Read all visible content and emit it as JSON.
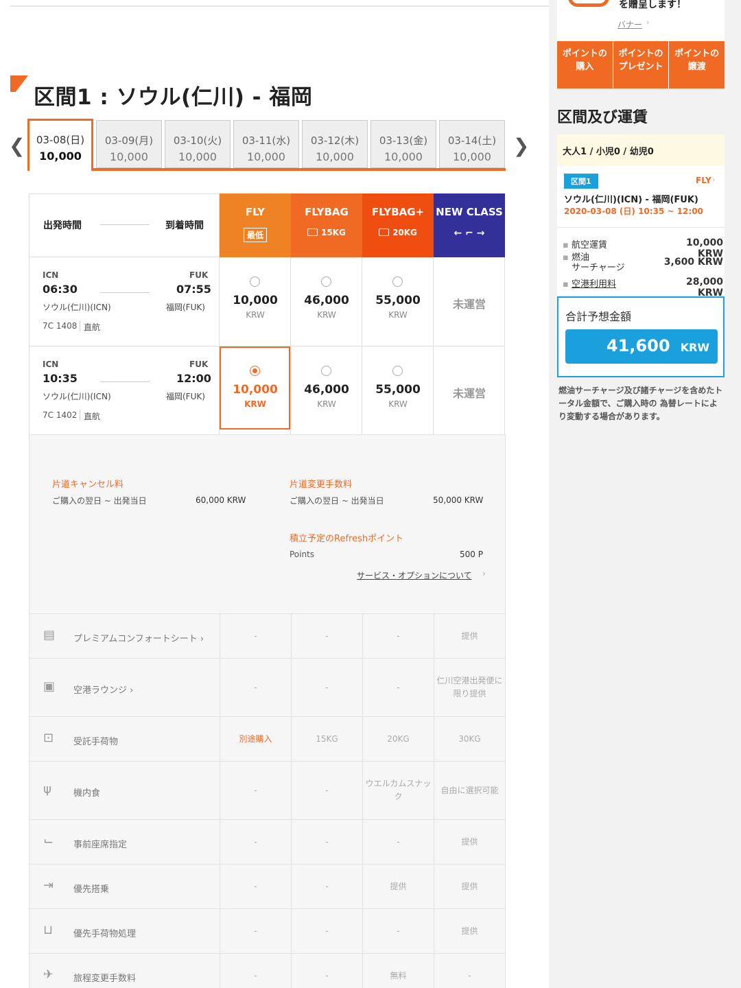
{
  "promo": {
    "text": "を贈呈します！",
    "link": "バナー"
  },
  "point_buttons": [
    "ポイントの\n購入",
    "ポイントの\nプレゼント",
    "ポイントの\n譲渡"
  ],
  "section": {
    "title": "区間1 : ソウル(仁川) - 福岡"
  },
  "date_tabs": [
    {
      "date": "03-08(日)",
      "price": "10,000"
    },
    {
      "date": "03-09(月)",
      "price": "10,000"
    },
    {
      "date": "03-10(火)",
      "price": "10,000"
    },
    {
      "date": "03-11(水)",
      "price": "10,000"
    },
    {
      "date": "03-12(木)",
      "price": "10,000"
    },
    {
      "date": "03-13(金)",
      "price": "10,000"
    },
    {
      "date": "03-14(土)",
      "price": "10,000"
    }
  ],
  "header": {
    "depart": "出発時間",
    "arrive": "到着時間"
  },
  "fare_classes": [
    {
      "name": "FLY",
      "sub": "最低",
      "color": "#f08226"
    },
    {
      "name": "FLYBAG",
      "sub": "15KG",
      "color": "#f06a24"
    },
    {
      "name": "FLYBAG+",
      "sub": "20KG",
      "color": "#f04e10"
    },
    {
      "name": "NEW CLASS",
      "sub": "← ⌐ →",
      "color": "#33309a"
    }
  ],
  "flights": [
    {
      "from_code": "ICN",
      "to_code": "FUK",
      "dep": "06:30",
      "arr": "07:55",
      "from_name": "ソウル(仁川)(ICN)",
      "to_name": "福岡(FUK)",
      "flight_no": "7C 1408",
      "type": "直航",
      "prices": [
        "10,000",
        "46,000",
        "55,000"
      ],
      "currency": "KRW",
      "na": "未運営"
    },
    {
      "from_code": "ICN",
      "to_code": "FUK",
      "dep": "10:35",
      "arr": "12:00",
      "from_name": "ソウル(仁川)(ICN)",
      "to_name": "福岡(FUK)",
      "flight_no": "7C 1402",
      "type": "直航",
      "prices": [
        "10,000",
        "46,000",
        "55,000"
      ],
      "currency": "KRW",
      "na": "未運営"
    }
  ],
  "details": {
    "cancel_title": "片道キャンセル料",
    "cancel_period": "ご購入の翌日 ~ 出発当日",
    "cancel_fee": "60,000 KRW",
    "change_title": "片道変更手数料",
    "change_period": "ご購入の翌日 ~ 出発当日",
    "change_fee": "50,000 KRW",
    "points_title": "積立予定のRefreshポイント",
    "points_label": "Points",
    "points_value": "500 P",
    "service_link": "サービス・オプションについて"
  },
  "features": [
    {
      "label": "プレミアムコンフォートシート",
      "icon": "seat-icon",
      "chev": true,
      "vals": [
        "-",
        "-",
        "-",
        "提供"
      ]
    },
    {
      "label": "空港ラウンジ",
      "icon": "lounge-icon",
      "chev": true,
      "vals": [
        "-",
        "-",
        "-",
        "仁川空港出発便に\n限り提供"
      ]
    },
    {
      "label": "受託手荷物",
      "icon": "baggage-icon",
      "chev": false,
      "vals": [
        "別途購入",
        "15KG",
        "20KG",
        "30KG"
      ]
    },
    {
      "label": "機内食",
      "icon": "meal-icon",
      "chev": false,
      "vals": [
        "-",
        "-",
        "ウエルカムスナッ\nク",
        "自由に選択可能"
      ]
    },
    {
      "label": "事前座席指定",
      "icon": "seat-select-icon",
      "chev": false,
      "vals": [
        "-",
        "-",
        "-",
        "提供"
      ]
    },
    {
      "label": "優先搭乗",
      "icon": "priority-boarding-icon",
      "chev": false,
      "vals": [
        "-",
        "-",
        "提供",
        "提供"
      ]
    },
    {
      "label": "優先手荷物処理",
      "icon": "priority-baggage-icon",
      "chev": false,
      "vals": [
        "-",
        "-",
        "-",
        "提供"
      ]
    },
    {
      "label": "旅程変更手数料",
      "icon": "change-fee-icon",
      "chev": false,
      "vals": [
        "-",
        "-",
        "無料",
        "-"
      ]
    }
  ],
  "summary": {
    "title": "区間及び運賃",
    "pax": "大人1 / 小児0 / 幼児0",
    "seg_badge": "区間1",
    "seg_class": "FLY",
    "route": "ソウル(仁川)(ICN) - 福岡(FUK)",
    "datetime": "2020-03-08 (日) 10:35 ~ 12:00",
    "fares": [
      {
        "label": "航空運賃",
        "value": "10,000 KRW"
      },
      {
        "label": "燃油\nサーチャージ",
        "value": "3,600 KRW"
      },
      {
        "label": "空港利用料",
        "value": "28,000 KRW"
      }
    ],
    "total_label": "合計予想金額",
    "total_value": "41,600",
    "total_currency": "KRW",
    "note": "燃油サーチャージ及び諸チャージを含めたトータル金額で、ご購入時の 為替レートにより変動する場合があります。"
  }
}
